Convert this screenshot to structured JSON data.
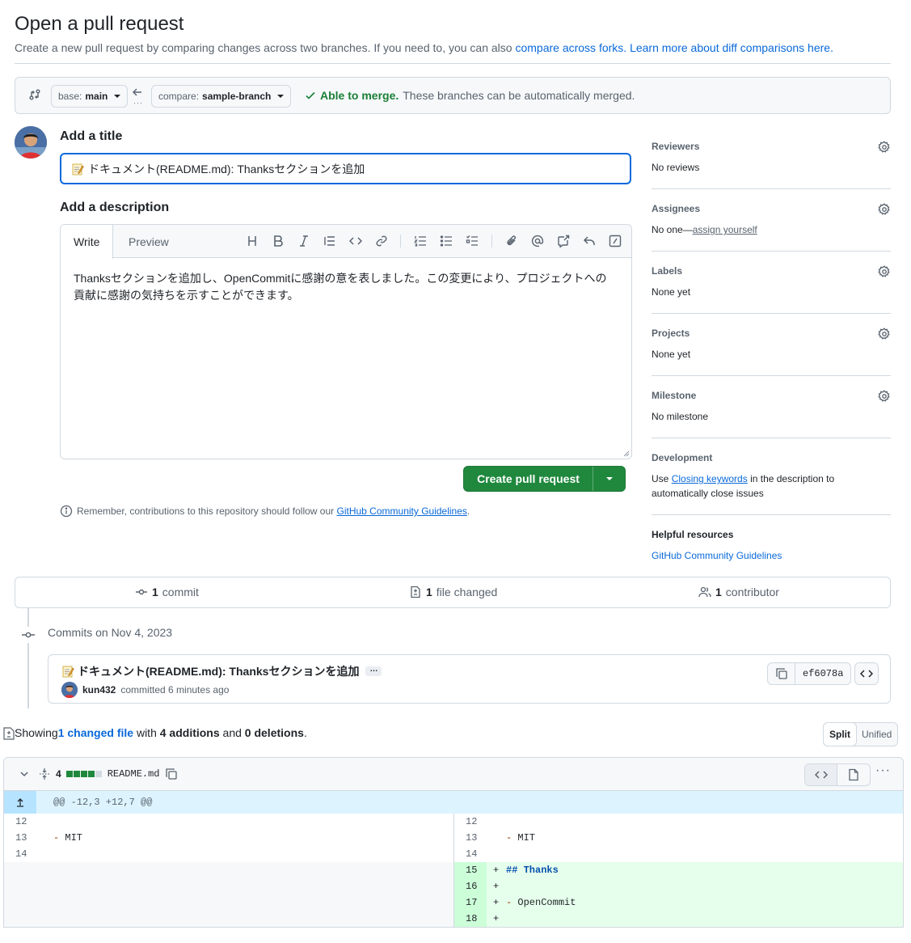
{
  "header": {
    "title": "Open a pull request",
    "subtitle_prefix": "Create a new pull request by comparing changes across two branches. If you need to, you can also ",
    "compare_forks_link": "compare across forks.",
    "learn_more_link": "Learn more about diff comparisons here."
  },
  "compare": {
    "base_prefix": "base:",
    "base_branch": "main",
    "compare_prefix": "compare:",
    "compare_branch": "sample-branch",
    "merge_status": "Able to merge.",
    "merge_detail": "These branches can be automatically merged."
  },
  "form": {
    "title_label": "Add a title",
    "title_value": "ドキュメント(README.md): Thanksセクションを追加",
    "description_label": "Add a description",
    "tab_write": "Write",
    "tab_preview": "Preview",
    "description_line1": "Thanksセクションを追加し、OpenCommitに感謝の意を表しました。この変更により、プロジェクトへの",
    "description_line2": "貢献に感謝の気持ちを示すことができます。",
    "create_button": "Create pull request",
    "reminder_prefix": "Remember, contributions to this repository should follow our ",
    "reminder_link": "GitHub Community Guidelines",
    "reminder_suffix": "."
  },
  "sidebar": {
    "reviewers_title": "Reviewers",
    "reviewers_value": "No reviews",
    "assignees_title": "Assignees",
    "assignees_value_prefix": "No one—",
    "assignees_link": "assign yourself",
    "labels_title": "Labels",
    "labels_value": "None yet",
    "projects_title": "Projects",
    "projects_value": "None yet",
    "milestone_title": "Milestone",
    "milestone_value": "No milestone",
    "development_title": "Development",
    "development_prefix": "Use ",
    "development_link": "Closing keywords",
    "development_suffix": " in the description to",
    "development_line2": "automatically close issues",
    "helpful_title": "Helpful resources",
    "helpful_link": "GitHub Community Guidelines"
  },
  "summary": {
    "commits_count": "1",
    "commits_label": "commit",
    "files_count": "1",
    "files_label": "file changed",
    "contributors_count": "1",
    "contributors_label": "contributor"
  },
  "commits": {
    "date_label": "Commits on Nov 4, 2023",
    "message": "ドキュメント(README.md): Thanksセクションを追加",
    "ellipsis": "…",
    "author": "kun432",
    "committed_text": "committed 6 minutes ago",
    "sha": "ef6078a"
  },
  "showing": {
    "prefix": "Showing ",
    "files_link": "1 changed file",
    "with": " with ",
    "additions": "4 additions",
    "and": " and ",
    "deletions": "0 deletions",
    "suffix": "."
  },
  "view_toggle": {
    "split": "Split",
    "unified": "Unified",
    "selected": "Split"
  },
  "diff": {
    "changes_count": "4",
    "filename": "README.md",
    "hunk_header": "@@ -12,3 +12,7 @@",
    "left_lines": [
      {
        "num": "12",
        "text": ""
      },
      {
        "num": "13",
        "text": "- MIT"
      },
      {
        "num": "14",
        "text": ""
      }
    ],
    "right_lines": [
      {
        "num": "12",
        "text": ""
      },
      {
        "num": "13",
        "text": "- MIT"
      },
      {
        "num": "14",
        "text": ""
      },
      {
        "num": "15",
        "text": "## Thanks"
      },
      {
        "num": "16",
        "text": ""
      },
      {
        "num": "17",
        "text": "- OpenCommit"
      },
      {
        "num": "18",
        "text": ""
      }
    ]
  },
  "colors": {
    "accent": "#0969da",
    "success": "#1a7f37",
    "button_green": "#1f883d",
    "addition_bg": "#e6ffec",
    "addition_num_bg": "#ccffd8",
    "hunk_bg": "#ddf4ff"
  }
}
